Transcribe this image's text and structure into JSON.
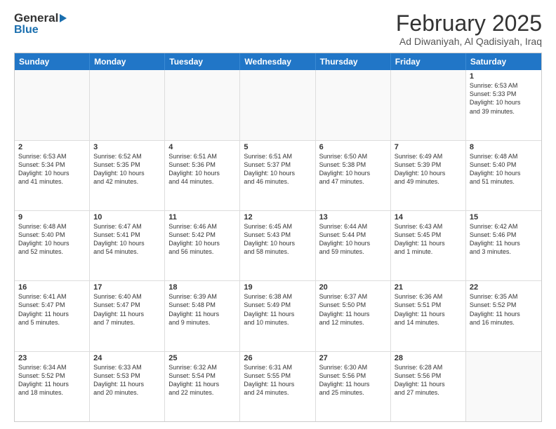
{
  "header": {
    "logo_general": "General",
    "logo_blue": "Blue",
    "main_title": "February 2025",
    "subtitle": "Ad Diwaniyah, Al Qadisiyah, Iraq"
  },
  "calendar": {
    "days_of_week": [
      "Sunday",
      "Monday",
      "Tuesday",
      "Wednesday",
      "Thursday",
      "Friday",
      "Saturday"
    ],
    "rows": [
      [
        {
          "day": "",
          "text": ""
        },
        {
          "day": "",
          "text": ""
        },
        {
          "day": "",
          "text": ""
        },
        {
          "day": "",
          "text": ""
        },
        {
          "day": "",
          "text": ""
        },
        {
          "day": "",
          "text": ""
        },
        {
          "day": "1",
          "text": "Sunrise: 6:53 AM\nSunset: 5:33 PM\nDaylight: 10 hours\nand 39 minutes."
        }
      ],
      [
        {
          "day": "2",
          "text": "Sunrise: 6:53 AM\nSunset: 5:34 PM\nDaylight: 10 hours\nand 41 minutes."
        },
        {
          "day": "3",
          "text": "Sunrise: 6:52 AM\nSunset: 5:35 PM\nDaylight: 10 hours\nand 42 minutes."
        },
        {
          "day": "4",
          "text": "Sunrise: 6:51 AM\nSunset: 5:36 PM\nDaylight: 10 hours\nand 44 minutes."
        },
        {
          "day": "5",
          "text": "Sunrise: 6:51 AM\nSunset: 5:37 PM\nDaylight: 10 hours\nand 46 minutes."
        },
        {
          "day": "6",
          "text": "Sunrise: 6:50 AM\nSunset: 5:38 PM\nDaylight: 10 hours\nand 47 minutes."
        },
        {
          "day": "7",
          "text": "Sunrise: 6:49 AM\nSunset: 5:39 PM\nDaylight: 10 hours\nand 49 minutes."
        },
        {
          "day": "8",
          "text": "Sunrise: 6:48 AM\nSunset: 5:40 PM\nDaylight: 10 hours\nand 51 minutes."
        }
      ],
      [
        {
          "day": "9",
          "text": "Sunrise: 6:48 AM\nSunset: 5:40 PM\nDaylight: 10 hours\nand 52 minutes."
        },
        {
          "day": "10",
          "text": "Sunrise: 6:47 AM\nSunset: 5:41 PM\nDaylight: 10 hours\nand 54 minutes."
        },
        {
          "day": "11",
          "text": "Sunrise: 6:46 AM\nSunset: 5:42 PM\nDaylight: 10 hours\nand 56 minutes."
        },
        {
          "day": "12",
          "text": "Sunrise: 6:45 AM\nSunset: 5:43 PM\nDaylight: 10 hours\nand 58 minutes."
        },
        {
          "day": "13",
          "text": "Sunrise: 6:44 AM\nSunset: 5:44 PM\nDaylight: 10 hours\nand 59 minutes."
        },
        {
          "day": "14",
          "text": "Sunrise: 6:43 AM\nSunset: 5:45 PM\nDaylight: 11 hours\nand 1 minute."
        },
        {
          "day": "15",
          "text": "Sunrise: 6:42 AM\nSunset: 5:46 PM\nDaylight: 11 hours\nand 3 minutes."
        }
      ],
      [
        {
          "day": "16",
          "text": "Sunrise: 6:41 AM\nSunset: 5:47 PM\nDaylight: 11 hours\nand 5 minutes."
        },
        {
          "day": "17",
          "text": "Sunrise: 6:40 AM\nSunset: 5:47 PM\nDaylight: 11 hours\nand 7 minutes."
        },
        {
          "day": "18",
          "text": "Sunrise: 6:39 AM\nSunset: 5:48 PM\nDaylight: 11 hours\nand 9 minutes."
        },
        {
          "day": "19",
          "text": "Sunrise: 6:38 AM\nSunset: 5:49 PM\nDaylight: 11 hours\nand 10 minutes."
        },
        {
          "day": "20",
          "text": "Sunrise: 6:37 AM\nSunset: 5:50 PM\nDaylight: 11 hours\nand 12 minutes."
        },
        {
          "day": "21",
          "text": "Sunrise: 6:36 AM\nSunset: 5:51 PM\nDaylight: 11 hours\nand 14 minutes."
        },
        {
          "day": "22",
          "text": "Sunrise: 6:35 AM\nSunset: 5:52 PM\nDaylight: 11 hours\nand 16 minutes."
        }
      ],
      [
        {
          "day": "23",
          "text": "Sunrise: 6:34 AM\nSunset: 5:52 PM\nDaylight: 11 hours\nand 18 minutes."
        },
        {
          "day": "24",
          "text": "Sunrise: 6:33 AM\nSunset: 5:53 PM\nDaylight: 11 hours\nand 20 minutes."
        },
        {
          "day": "25",
          "text": "Sunrise: 6:32 AM\nSunset: 5:54 PM\nDaylight: 11 hours\nand 22 minutes."
        },
        {
          "day": "26",
          "text": "Sunrise: 6:31 AM\nSunset: 5:55 PM\nDaylight: 11 hours\nand 24 minutes."
        },
        {
          "day": "27",
          "text": "Sunrise: 6:30 AM\nSunset: 5:56 PM\nDaylight: 11 hours\nand 25 minutes."
        },
        {
          "day": "28",
          "text": "Sunrise: 6:28 AM\nSunset: 5:56 PM\nDaylight: 11 hours\nand 27 minutes."
        },
        {
          "day": "",
          "text": ""
        }
      ]
    ]
  }
}
